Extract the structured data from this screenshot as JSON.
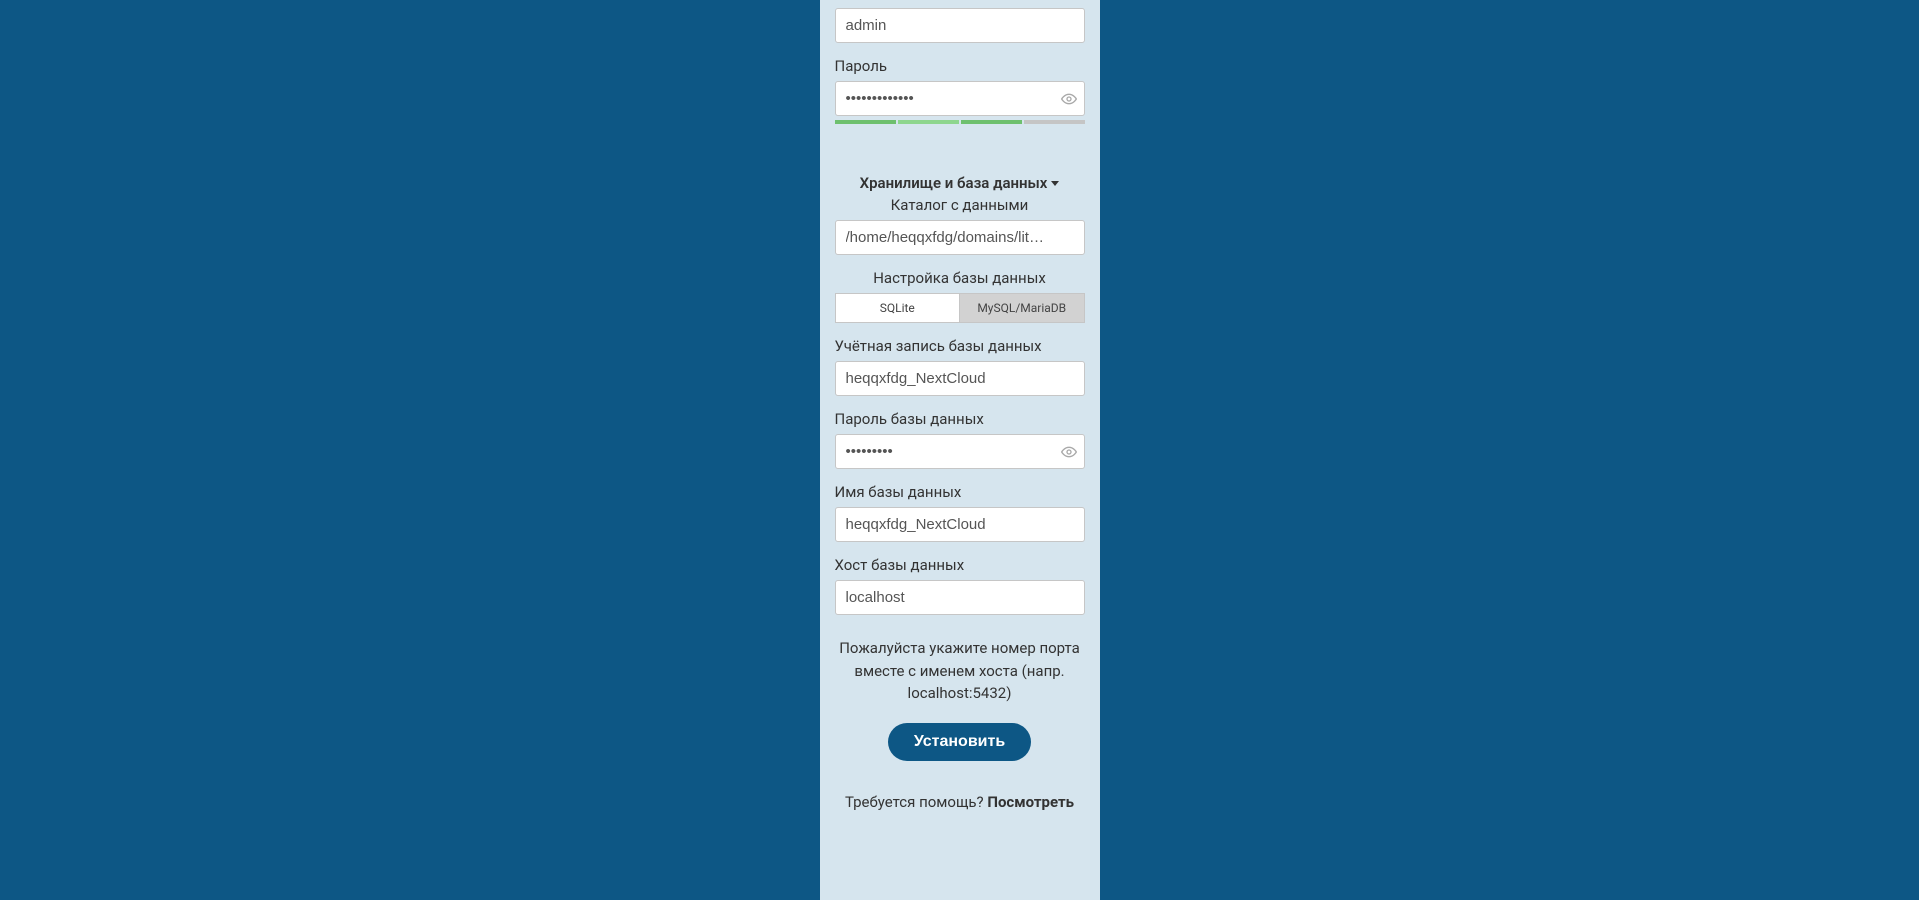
{
  "admin": {
    "username": "admin",
    "password_label": "Пароль",
    "password_value": "•••••••••••••"
  },
  "storage": {
    "section_title": "Хранилище и база данных",
    "data_dir_label": "Каталог с данными",
    "data_dir_value": "/home/heqqxfdg/domains/lit…",
    "db_config_label": "Настройка базы данных"
  },
  "db_tabs": {
    "sqlite": "SQLite",
    "mysql": "MySQL/MariaDB"
  },
  "db": {
    "user_label": "Учётная запись базы данных",
    "user_value": "heqqxfdg_NextCloud",
    "password_label": "Пароль базы данных",
    "password_value": "•••••••••",
    "name_label": "Имя базы данных",
    "name_value": "heqqxfdg_NextCloud",
    "host_label": "Хост базы данных",
    "host_value": "localhost"
  },
  "host_hint": "Пожалуйста укажите номер порта вместе с именем хоста (напр. localhost:5432)",
  "install_button": "Установить",
  "help": {
    "prefix": "Требуется помощь? ",
    "link": "Посмотреть"
  }
}
